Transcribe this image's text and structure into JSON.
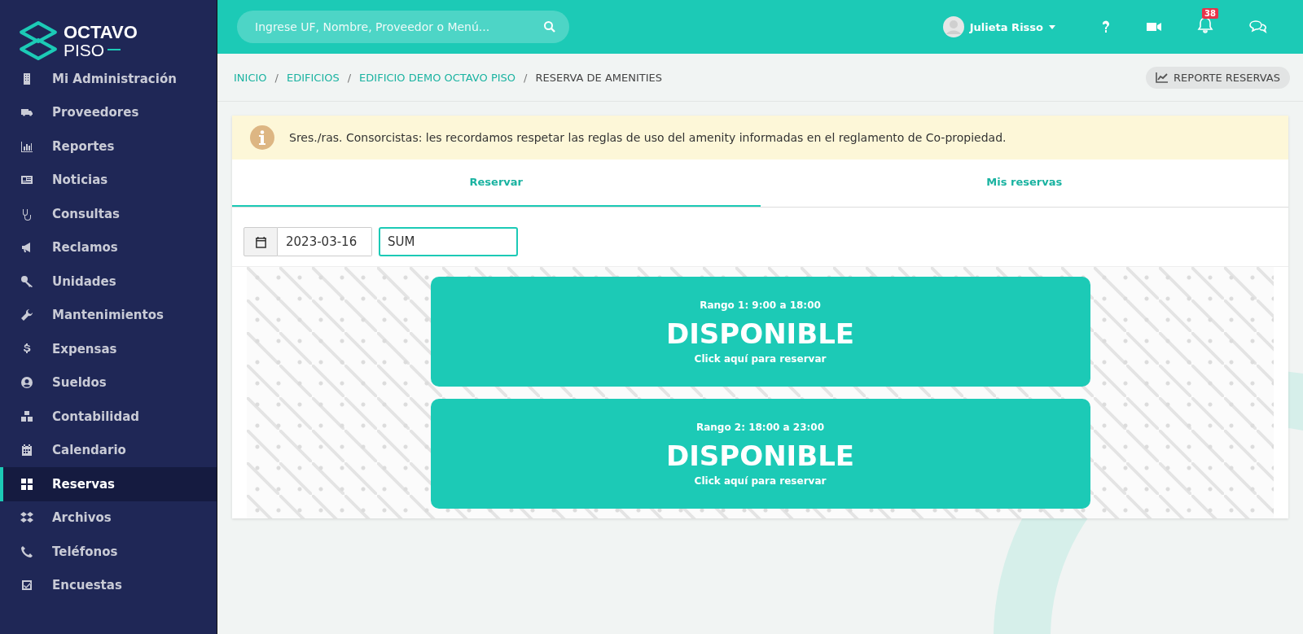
{
  "logo": {
    "line1": "OCTAVO",
    "line2": "PISO"
  },
  "sidebar": {
    "items": [
      {
        "label": "Mi Administración",
        "selected": false
      },
      {
        "label": "Proveedores",
        "selected": false
      },
      {
        "label": "Reportes",
        "selected": false
      },
      {
        "label": "Noticias",
        "selected": false
      },
      {
        "label": "Consultas",
        "selected": false
      },
      {
        "label": "Reclamos",
        "selected": false
      },
      {
        "label": "Unidades",
        "selected": false
      },
      {
        "label": "Mantenimientos",
        "selected": false
      },
      {
        "label": "Expensas",
        "selected": false
      },
      {
        "label": "Sueldos",
        "selected": false
      },
      {
        "label": "Contabilidad",
        "selected": false
      },
      {
        "label": "Calendario",
        "selected": false
      },
      {
        "label": "Reservas",
        "selected": true
      },
      {
        "label": "Archivos",
        "selected": false
      },
      {
        "label": "Teléfonos",
        "selected": false
      },
      {
        "label": "Encuestas",
        "selected": false
      }
    ]
  },
  "topbar": {
    "search": {
      "placeholder": "Ingrese UF, Nombre, Proveedor o Menú..."
    },
    "user": "Julieta Risso",
    "notifications": "38"
  },
  "breadcrumb": [
    {
      "label": "INICIO"
    },
    {
      "separator": "/",
      "label": "EDIFICIOS"
    },
    {
      "separator": "/",
      "label": "EDIFICIO DEMO OCTAVO PISO"
    },
    {
      "separator": "/",
      "label": "RESERVA DE AMENITIES"
    }
  ],
  "report_button": "REPORTE RESERVAS",
  "alert": "Sres./ras. Consorcistas: les recordamos respetar las reglas de uso del amenity informadas en el reglamento de Co-propiedad.",
  "tabs": [
    {
      "label": "Reservar",
      "selected": true
    },
    {
      "label": "Mis reservas",
      "selected": false
    }
  ],
  "filters": {
    "date": "2023-03-16",
    "amenity": "SUM"
  },
  "slots": [
    {
      "range": "Rango 1: 9:00 a 18:00",
      "status": "DISPONIBLE",
      "action": "Click aquí para reservar"
    },
    {
      "range": "Rango 2: 18:00 a 23:00",
      "status": "DISPONIBLE",
      "action": "Click aquí para reservar"
    }
  ]
}
